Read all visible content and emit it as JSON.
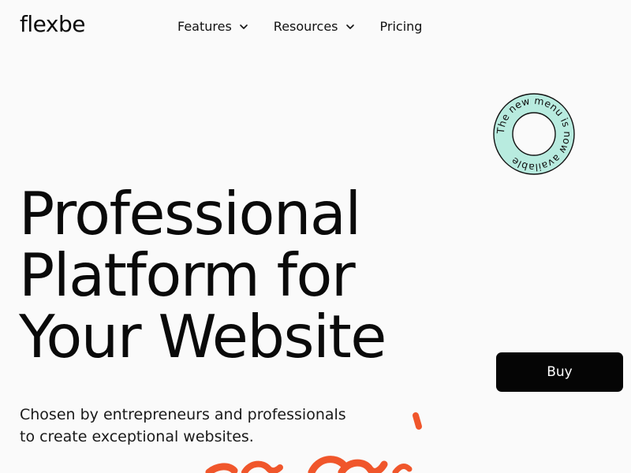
{
  "header": {
    "logo_text": "flexbe",
    "nav": [
      {
        "label": "Features",
        "has_dropdown": true,
        "icon": "chevron-down-icon"
      },
      {
        "label": "Resources",
        "has_dropdown": true,
        "icon": "chevron-down-icon"
      },
      {
        "label": "Pricing",
        "has_dropdown": false
      }
    ]
  },
  "badge": {
    "text": "The new menu is now available",
    "color": "#b8ebdf"
  },
  "hero": {
    "title_lines": [
      "Professional",
      "Platform for",
      "Your Website"
    ],
    "subtitle_lines": [
      "Chosen by entrepreneurs and professionals",
      "to create exceptional websites."
    ]
  },
  "cta": {
    "buy_label": "Buy"
  },
  "colors": {
    "background": "#fafafa",
    "text": "#0a0a0a",
    "button_bg": "#050505",
    "accent_brush": "#f0562b"
  }
}
